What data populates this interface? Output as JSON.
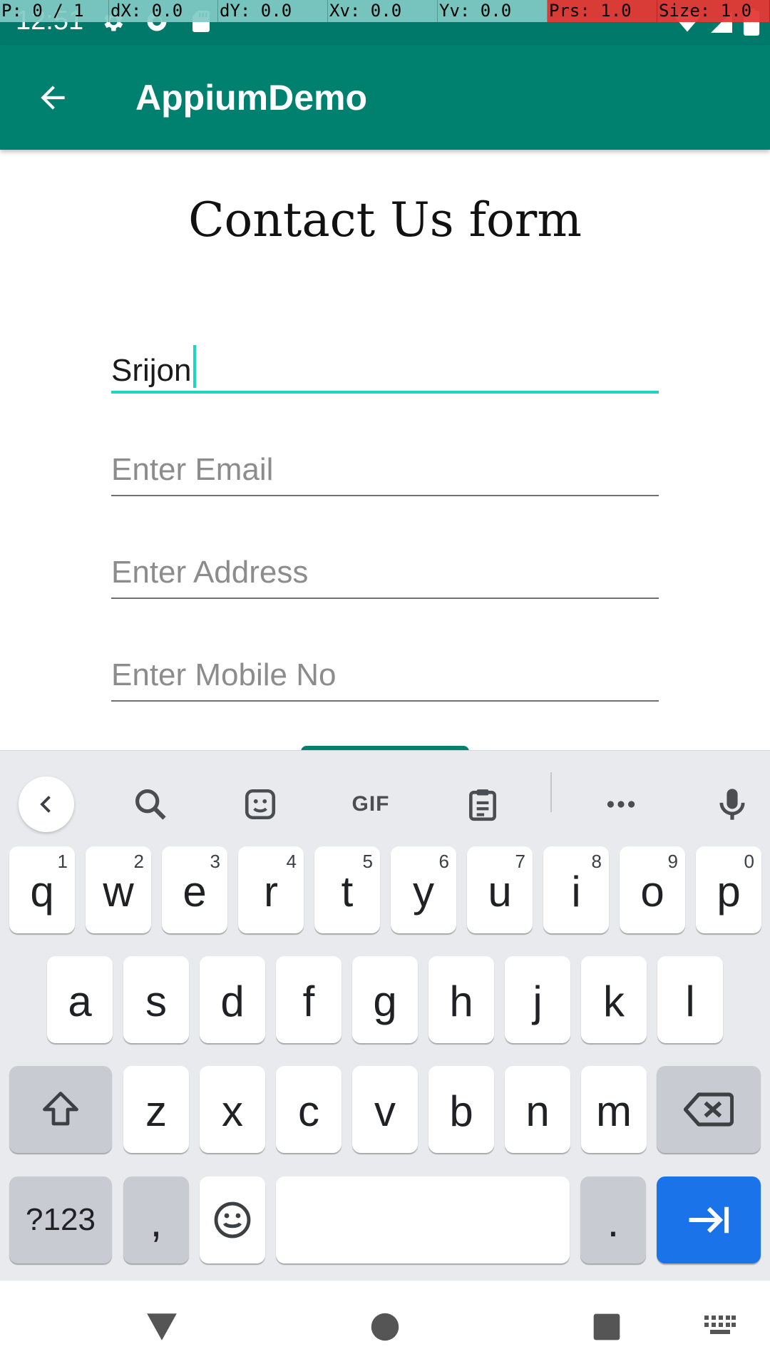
{
  "status_bar": {
    "time": "12:51",
    "icons": [
      "settings-icon",
      "sync-icon",
      "sd-card-icon",
      "wifi-icon",
      "signal-icon",
      "battery-icon"
    ]
  },
  "pointer_overlay": {
    "pointer": "P: 0 / 1",
    "dx": "dX: 0.0",
    "dy": "dY: 0.0",
    "xv": "Xv: 0.0",
    "yv": "Yv: 0.0",
    "prs": "Prs: 1.0",
    "size": "Size: 1.0"
  },
  "app_bar": {
    "title": "AppiumDemo",
    "back_icon": "arrow-back-icon"
  },
  "form": {
    "title": "Contact Us form",
    "name_value": "Srijon",
    "email_placeholder": "Enter Email",
    "address_placeholder": "Enter Address",
    "mobile_placeholder": "Enter Mobile No"
  },
  "keyboard": {
    "row1": [
      {
        "k": "q",
        "h": "1"
      },
      {
        "k": "w",
        "h": "2"
      },
      {
        "k": "e",
        "h": "3"
      },
      {
        "k": "r",
        "h": "4"
      },
      {
        "k": "t",
        "h": "5"
      },
      {
        "k": "y",
        "h": "6"
      },
      {
        "k": "u",
        "h": "7"
      },
      {
        "k": "i",
        "h": "8"
      },
      {
        "k": "o",
        "h": "9"
      },
      {
        "k": "p",
        "h": "0"
      }
    ],
    "row2": [
      "a",
      "s",
      "d",
      "f",
      "g",
      "h",
      "j",
      "k",
      "l"
    ],
    "row3": [
      "z",
      "x",
      "c",
      "v",
      "b",
      "n",
      "m"
    ],
    "symbols_label": "?123",
    "comma_label": ",",
    "period_label": ".",
    "gif_label": "GIF",
    "colors": {
      "background": "#e8eaed",
      "key": "#ffffff",
      "function_key": "#c8ccd2",
      "action_key": "#1a73e8"
    }
  },
  "colors": {
    "app_bar": "#00806f",
    "status_bar": "#00796b",
    "accent": "#1dd5c3"
  }
}
